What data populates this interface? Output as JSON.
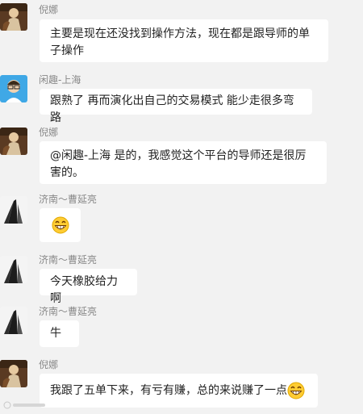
{
  "conversation": {
    "messages": [
      {
        "sender": "倪娜",
        "avatar": "avatar-nina-icon",
        "text": "主要是现在还没找到操作方法，现在都是跟导师的单子操作"
      },
      {
        "sender": "闲趣-上海",
        "avatar": "avatar-xianqu-icon",
        "text": "跟熟了 再而演化出自己的交易模式 能少走很多弯路"
      },
      {
        "sender": "倪娜",
        "avatar": "avatar-nina-icon",
        "text": "@闲趣-上海 是的，我感觉这个平台的导师还是很厉害的。"
      },
      {
        "sender": "济南～曹延亮",
        "avatar": "avatar-jinan-icon",
        "text": "",
        "emoji": "grin-emoji-icon"
      },
      {
        "sender": "济南～曹延亮",
        "avatar": "avatar-jinan-icon",
        "text": "今天橡胶给力啊"
      },
      {
        "sender": "济南～曹延亮",
        "avatar": "avatar-jinan-icon",
        "text": "牛"
      },
      {
        "sender": "倪娜",
        "avatar": "avatar-nina-icon",
        "text": "我跟了五单下来，有亏有赚，总的来说赚了一点",
        "emoji": "grin-emoji-icon"
      }
    ]
  },
  "colors": {
    "background": "#f2f2f2",
    "bubble": "#ffffff",
    "sender_name": "#888888",
    "text": "#222222"
  }
}
